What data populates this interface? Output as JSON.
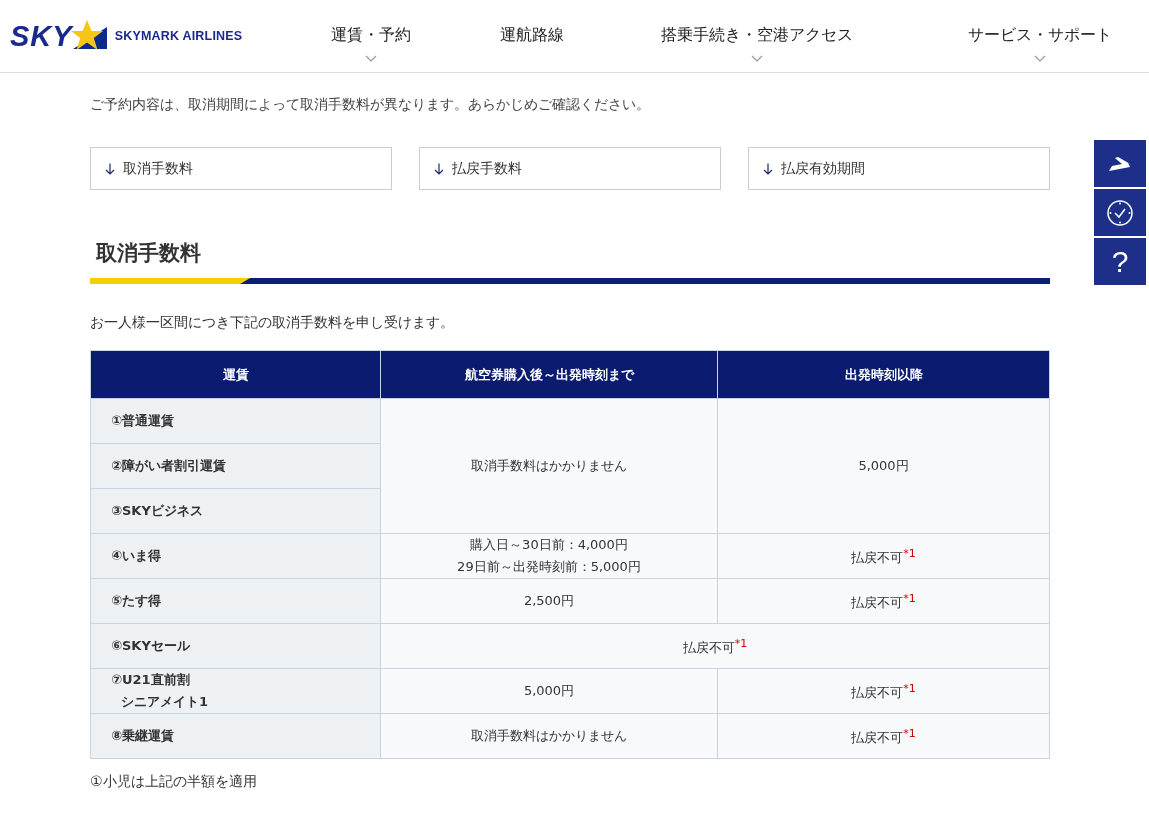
{
  "header": {
    "logo": {
      "mark": "SKY",
      "name": "SKYMARK AIRLINES"
    },
    "nav": [
      {
        "label": "運賃・予約",
        "has_menu": true
      },
      {
        "label": "運航路線",
        "has_menu": false
      },
      {
        "label": "搭乗手続き・空港アクセス",
        "has_menu": true
      },
      {
        "label": "サービス・サポート",
        "has_menu": true
      }
    ]
  },
  "intro": "ご予約内容は、取消期間によって取消手数料が異なります。あらかじめご確認ください。",
  "anchors": [
    "取消手数料",
    "払戻手数料",
    "払戻有効期間"
  ],
  "section": {
    "title": "取消手数料",
    "description": "お一人様一区間につき下記の取消手数料を申し受けます。",
    "table": {
      "columns": [
        "運賃",
        "航空券購入後～出発時刻まで",
        "出発時刻以降"
      ],
      "groups": [
        {
          "labels": [
            [
              "①普通運賃"
            ],
            [
              "②障がい者割引運賃"
            ],
            [
              "③SKYビジネス"
            ]
          ],
          "cells": [
            {
              "lines": [
                "取消手数料はかかりません"
              ],
              "wide": false
            },
            {
              "lines": [
                "5,000円"
              ],
              "wide": false
            }
          ]
        },
        {
          "labels": [
            [
              "④いま得"
            ]
          ],
          "cells": [
            {
              "lines": [
                "購入日～30日前：4,000円",
                "29日前～出発時刻前：5,000円"
              ],
              "wide": false
            },
            {
              "lines": [
                "払戻不可$^{*1}$"
              ],
              "wide": false
            }
          ]
        },
        {
          "labels": [
            [
              "⑤たす得"
            ]
          ],
          "cells": [
            {
              "lines": [
                "2,500円"
              ],
              "wide": false
            },
            {
              "lines": [
                "払戻不可$^{*1}$"
              ],
              "wide": false
            }
          ]
        },
        {
          "labels": [
            [
              "⑥SKYセール"
            ]
          ],
          "cells": [
            {
              "lines": [
                "払戻不可$^{*1}$"
              ],
              "wide": true
            }
          ]
        },
        {
          "labels": [
            [
              "⑦U21直前割",
              "シニアメイト1"
            ]
          ],
          "cells": [
            {
              "lines": [
                "5,000円"
              ],
              "wide": false
            },
            {
              "lines": [
                "払戻不可$^{*1}$"
              ],
              "wide": false
            }
          ]
        },
        {
          "labels": [
            [
              "⑧乗継運賃"
            ]
          ],
          "cells": [
            {
              "lines": [
                "取消手数料はかかりません"
              ],
              "wide": false
            },
            {
              "lines": [
                "払戻不可$^{*1}$"
              ],
              "wide": false
            }
          ]
        }
      ]
    },
    "notes": [
      "①小児は上記の半額を適用"
    ]
  },
  "side_buttons": [
    {
      "kind": "plane"
    },
    {
      "kind": "clock"
    },
    {
      "kind": "help",
      "label": "?"
    }
  ]
}
